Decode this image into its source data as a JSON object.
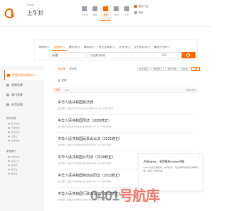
{
  "header": {
    "greeting_sub": "Email",
    "greeting": "上午好",
    "nav": [
      {
        "label": "工作台",
        "icon": "desk-icon",
        "active": false
      },
      {
        "label": "检索",
        "icon": "search-icon",
        "active": false
      },
      {
        "label": "法规",
        "icon": "book-icon",
        "active": true
      },
      {
        "label": "案例",
        "icon": "case-icon",
        "active": false
      },
      {
        "label": "文书",
        "icon": "doc-icon",
        "active": false
      }
    ],
    "links": [
      "更多产品",
      "我的"
    ]
  },
  "search": {
    "tabs": [
      {
        "label": "案例(99+)",
        "active": false
      },
      {
        "label": "法规(99+)",
        "active": true
      },
      {
        "label": "期刊(99+)",
        "active": false
      },
      {
        "label": "律师(99+)",
        "active": false
      },
      {
        "label": "专业文章(99+)",
        "active": false
      },
      {
        "label": "文书(99+)",
        "active": false
      },
      {
        "label": "文书范本(99+)",
        "active": false
      },
      {
        "label": "裁判文书(99+)",
        "active": false
      }
    ],
    "scope": "标题",
    "placeholder": "在结果中检索",
    "advanced": "高级"
  },
  "sidebar": {
    "items": [
      {
        "label": "中国大陆法规(99+)",
        "active": true
      },
      {
        "label": "香港法规",
        "active": false
      },
      {
        "label": "澳门法规",
        "active": false
      },
      {
        "label": "台湾法规",
        "active": false
      }
    ],
    "group1": "效力状态",
    "group2": "发布部门",
    "sub": [
      "现行有效",
      "已被修改",
      "部分失效",
      "已废止",
      "尚未生效",
      "中共中央",
      "全国人大",
      "国务院",
      "最高法",
      "最高检"
    ]
  },
  "main": {
    "sort_tabs": [
      {
        "label": "相关度",
        "active": true
      },
      {
        "label": "时效性",
        "active": false
      }
    ],
    "filters": [
      {
        "label": "效力级别",
        "on": false
      },
      {
        "label": "发布部门",
        "on": false
      },
      {
        "label": "发布日期",
        "on": false
      },
      {
        "label": "时效性",
        "on": false
      },
      {
        "label": "分类",
        "on": true
      }
    ],
    "option": "全选",
    "result_title": "法律",
    "result_count": "(99+)",
    "result_sort": "按相关排序",
    "results": [
      {
        "title": "中华人民共和国民法典",
        "meta": "发文部门 全国人民代表大会 发布日期 2020.05.28 现行有效"
      },
      {
        "title": "中华人民共和国刑法（2020修正）",
        "meta": "发文部门 全国人大常委会 发布日期 2020.12.26 现行有效"
      },
      {
        "title": "中华人民共和国民事诉讼法（2021修正）",
        "meta": "发文部门 全国人大常委会 发布日期 2021.12.24 现行有效"
      },
      {
        "title": "中华人民共和国公司法（2018修正）",
        "meta": "发文部门 全国人大常委会 发布日期 2018.10.26 现行有效"
      },
      {
        "title": "中华人民共和国劳动合同法（2012修正）",
        "meta": "发文部门 全国人大常委会 发布日期 2012.12.28 现行有效"
      },
      {
        "title": "中华人民共和国行政诉讼法（2017修正）",
        "meta": "发文部门 全国人大常委会 发布日期 2017.06.27 现行有效"
      }
    ]
  },
  "promo": {
    "title": "开启Alpha，享受更多codice功能",
    "text": "Alpha 提供法规检索、案例检索、专业律师和律所查询等功能，助您工作更高效。"
  },
  "watermark": {
    "a": "0401",
    "b": "号航库"
  },
  "colors": {
    "accent": "#ff6a00"
  }
}
